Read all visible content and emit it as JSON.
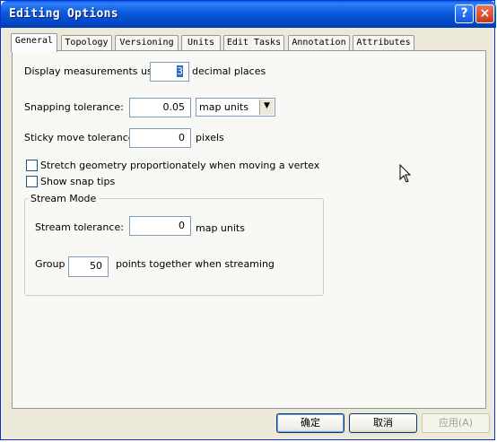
{
  "window": {
    "title": "Editing Options",
    "help_label": "?",
    "close_label": "×"
  },
  "tabs": [
    "General",
    "Topology",
    "Versioning",
    "Units",
    "Edit Tasks",
    "Annotation",
    "Attributes"
  ],
  "general": {
    "display_pre": "Display measurements using",
    "display_value": "3",
    "display_post": "decimal places",
    "snapping_label": "Snapping tolerance:",
    "snapping_value": "0.05",
    "snapping_units": "map units",
    "sticky_label": "Sticky move tolerance:",
    "sticky_value": "0",
    "sticky_units": "pixels",
    "stretch_label": "Stretch geometry proportionately when moving a vertex",
    "stretch_checked": false,
    "snaptips_label": "Show snap tips",
    "snaptips_checked": false
  },
  "stream": {
    "title": "Stream Mode",
    "tolerance_label": "Stream tolerance:",
    "tolerance_value": "0",
    "tolerance_units": "map units",
    "group_label": "Group",
    "group_value": "50",
    "group_post": "points together when streaming"
  },
  "buttons": {
    "ok": "确定",
    "cancel": "取消",
    "apply": "应用(A)"
  },
  "colors": {
    "titlebar": "#0a58dc",
    "dialog_bg": "#ece9d8",
    "selection": "#316ac5"
  }
}
